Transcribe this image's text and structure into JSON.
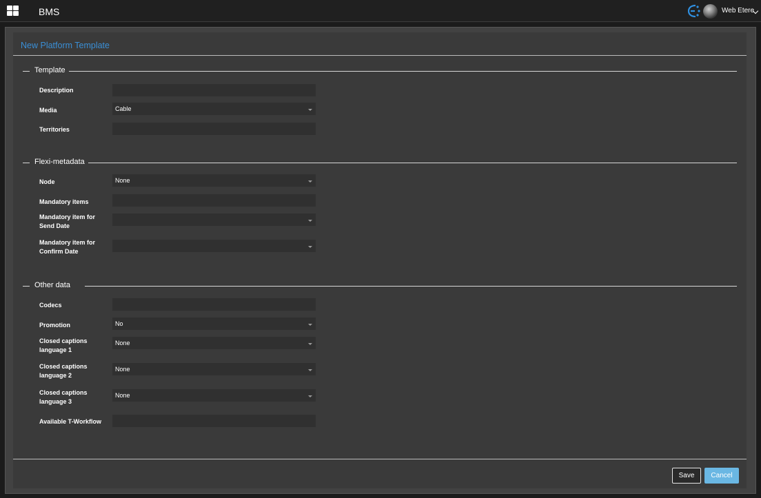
{
  "header": {
    "app_title": "BMS",
    "user_name": "Web Etere",
    "icons": {
      "menu": "grid-icon",
      "brand": "etere-logo-icon",
      "user": "avatar",
      "chevron": "chevron-down-icon"
    }
  },
  "panel": {
    "title": "New Platform Template"
  },
  "sections": {
    "template": {
      "legend": "Template",
      "fields": {
        "description": {
          "label": "Description",
          "value": ""
        },
        "media": {
          "label": "Media",
          "value": "Cable"
        },
        "territories": {
          "label": "Territories",
          "value": ""
        }
      }
    },
    "flexi": {
      "legend": "Flexi-metadata",
      "fields": {
        "node": {
          "label": "Node",
          "value": "None"
        },
        "mandatory_items": {
          "label": "Mandatory items",
          "value": ""
        },
        "send_date": {
          "label1": "Mandatory item for",
          "label2": "Send Date",
          "value": ""
        },
        "confirm_date": {
          "label1": "Mandatory item for",
          "label2": "Confirm Date",
          "value": ""
        }
      }
    },
    "other": {
      "legend": "Other data",
      "fields": {
        "codecs": {
          "label": "Codecs",
          "value": ""
        },
        "promotion": {
          "label": "Promotion",
          "value": "No"
        },
        "cc1": {
          "label1": "Closed captions",
          "label2": "language 1",
          "value": "None"
        },
        "cc2": {
          "label1": "Closed captions",
          "label2": "language 2",
          "value": "None"
        },
        "cc3": {
          "label1": "Closed captions",
          "label2": "language 3",
          "value": "None"
        },
        "workflow": {
          "label": "Available T-Workflow",
          "value": ""
        }
      }
    }
  },
  "buttons": {
    "save": "Save",
    "cancel": "Cancel"
  },
  "colors": {
    "accent": "#3a8fd6",
    "cancel_button": "#6ab7e3",
    "panel_bg": "#3a3a3a",
    "input_bg": "#303030"
  }
}
